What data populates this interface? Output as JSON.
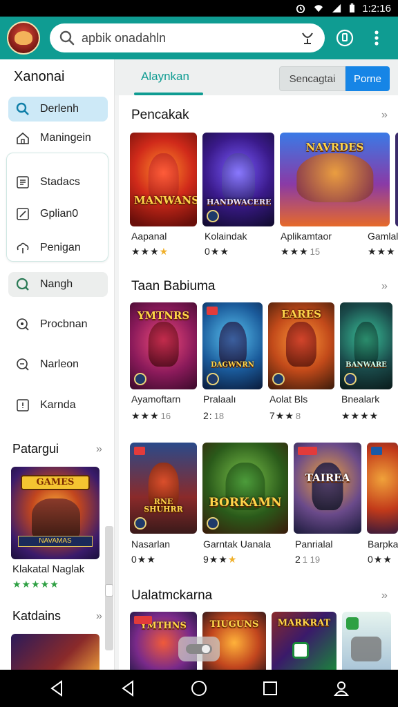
{
  "status_bar": {
    "time": "1:2:16",
    "icons": [
      "alarm-icon",
      "wifi-icon",
      "signal-icon",
      "battery-icon"
    ]
  },
  "header": {
    "app_logo": "game-avatar-logo",
    "search_placeholder": "apbik onadahln",
    "actions": [
      "voice-search-icon",
      "account-icon",
      "more-vert-icon"
    ]
  },
  "sidebar": {
    "title": "Xanonai",
    "items": [
      {
        "label": "Derlenh",
        "icon": "search-icon"
      },
      {
        "label": "Maningein",
        "icon": "home-icon"
      },
      {
        "label": "Stadacs",
        "icon": "list-icon"
      },
      {
        "label": "Gplian0",
        "icon": "edit-icon"
      },
      {
        "label": "Penigan",
        "icon": "cloud-icon"
      },
      {
        "label": "Nangh",
        "icon": "search-icon"
      },
      {
        "label": "Procbnan",
        "icon": "zoom-icon"
      },
      {
        "label": "Narleon",
        "icon": "zoom-icon"
      },
      {
        "label": "Karnda",
        "icon": "square-icon"
      }
    ],
    "sections": [
      {
        "title": "Patargui",
        "chevron": "› ›",
        "card_caption": "Klakatal Naglak",
        "rating": "★★★★★"
      },
      {
        "title": "Katdains",
        "chevron": "› ›"
      }
    ]
  },
  "tabs": {
    "active": "Alaynkan",
    "segment": "Sencagtai",
    "segment_active": "Porne"
  },
  "sections": [
    {
      "title": "Pencakak",
      "chevron": "› ›",
      "items": [
        {
          "art_text": "MANWANS",
          "caption": "Aapanal",
          "stars": "★★★",
          "half": "★",
          "num": ""
        },
        {
          "art_text": "HANDWACERE",
          "caption": "Kolaindak",
          "stars": "0★★",
          "half": "",
          "num": ""
        },
        {
          "art_text": "NAVRDES",
          "caption": "Aplikamtaor",
          "stars": "★★★",
          "half": "",
          "num": "15"
        },
        {
          "art_text": "",
          "caption": "Gamlal",
          "stars": "★★★",
          "half": "",
          "num": ""
        }
      ]
    },
    {
      "title": "Taan Babiuma",
      "chevron": "› ›",
      "items": [
        {
          "art_text": "YMTNRS",
          "caption": "Ayamoftarn",
          "stars": "★★★",
          "half": "",
          "num": "16"
        },
        {
          "art_text": "DAGWNRN",
          "caption": "Pralaalı",
          "stars": "2:",
          "half": "",
          "num": "18"
        },
        {
          "art_text": "EARES",
          "caption": "Aolat Bls",
          "stars": "7★★",
          "half": "",
          "num": "8"
        },
        {
          "art_text": "BANWARE",
          "caption": "Bnealark",
          "stars": "★★★★",
          "half": "",
          "num": ""
        }
      ]
    },
    {
      "title": "",
      "chevron": "",
      "items": [
        {
          "art_text": "RNE SHUHRR",
          "caption": "Nasarlan",
          "stars": "0★★",
          "half": "",
          "num": ""
        },
        {
          "art_text": "BORKAMN",
          "caption": "Garntak Uanala",
          "stars": "9★★",
          "half": "★",
          "num": ""
        },
        {
          "art_text": "TAIREA",
          "caption": "Panrialal",
          "stars": "2",
          "half": "",
          "num": "1 19"
        },
        {
          "art_text": "",
          "caption": "Barpka",
          "stars": "0★★",
          "half": "",
          "num": ""
        }
      ]
    },
    {
      "title": "Ualatmckarna",
      "chevron": "› ›",
      "items": [
        {
          "art_text": "YMTHNS",
          "caption": "",
          "stars": "",
          "half": "",
          "num": ""
        },
        {
          "art_text": "TIUGUNS",
          "caption": "",
          "stars": "",
          "half": "",
          "num": ""
        },
        {
          "art_text": "MARKRAT",
          "caption": "",
          "stars": "",
          "half": "",
          "num": ""
        },
        {
          "art_text": "",
          "caption": "",
          "stars": "",
          "half": "",
          "num": ""
        }
      ]
    }
  ],
  "bottom_nav": [
    "back-icon",
    "back-icon",
    "home-circle-icon",
    "recents-icon",
    "person-icon"
  ],
  "colors": {
    "accent": "#0f9c92",
    "blue": "#1685e6",
    "star": "#2ea043"
  }
}
